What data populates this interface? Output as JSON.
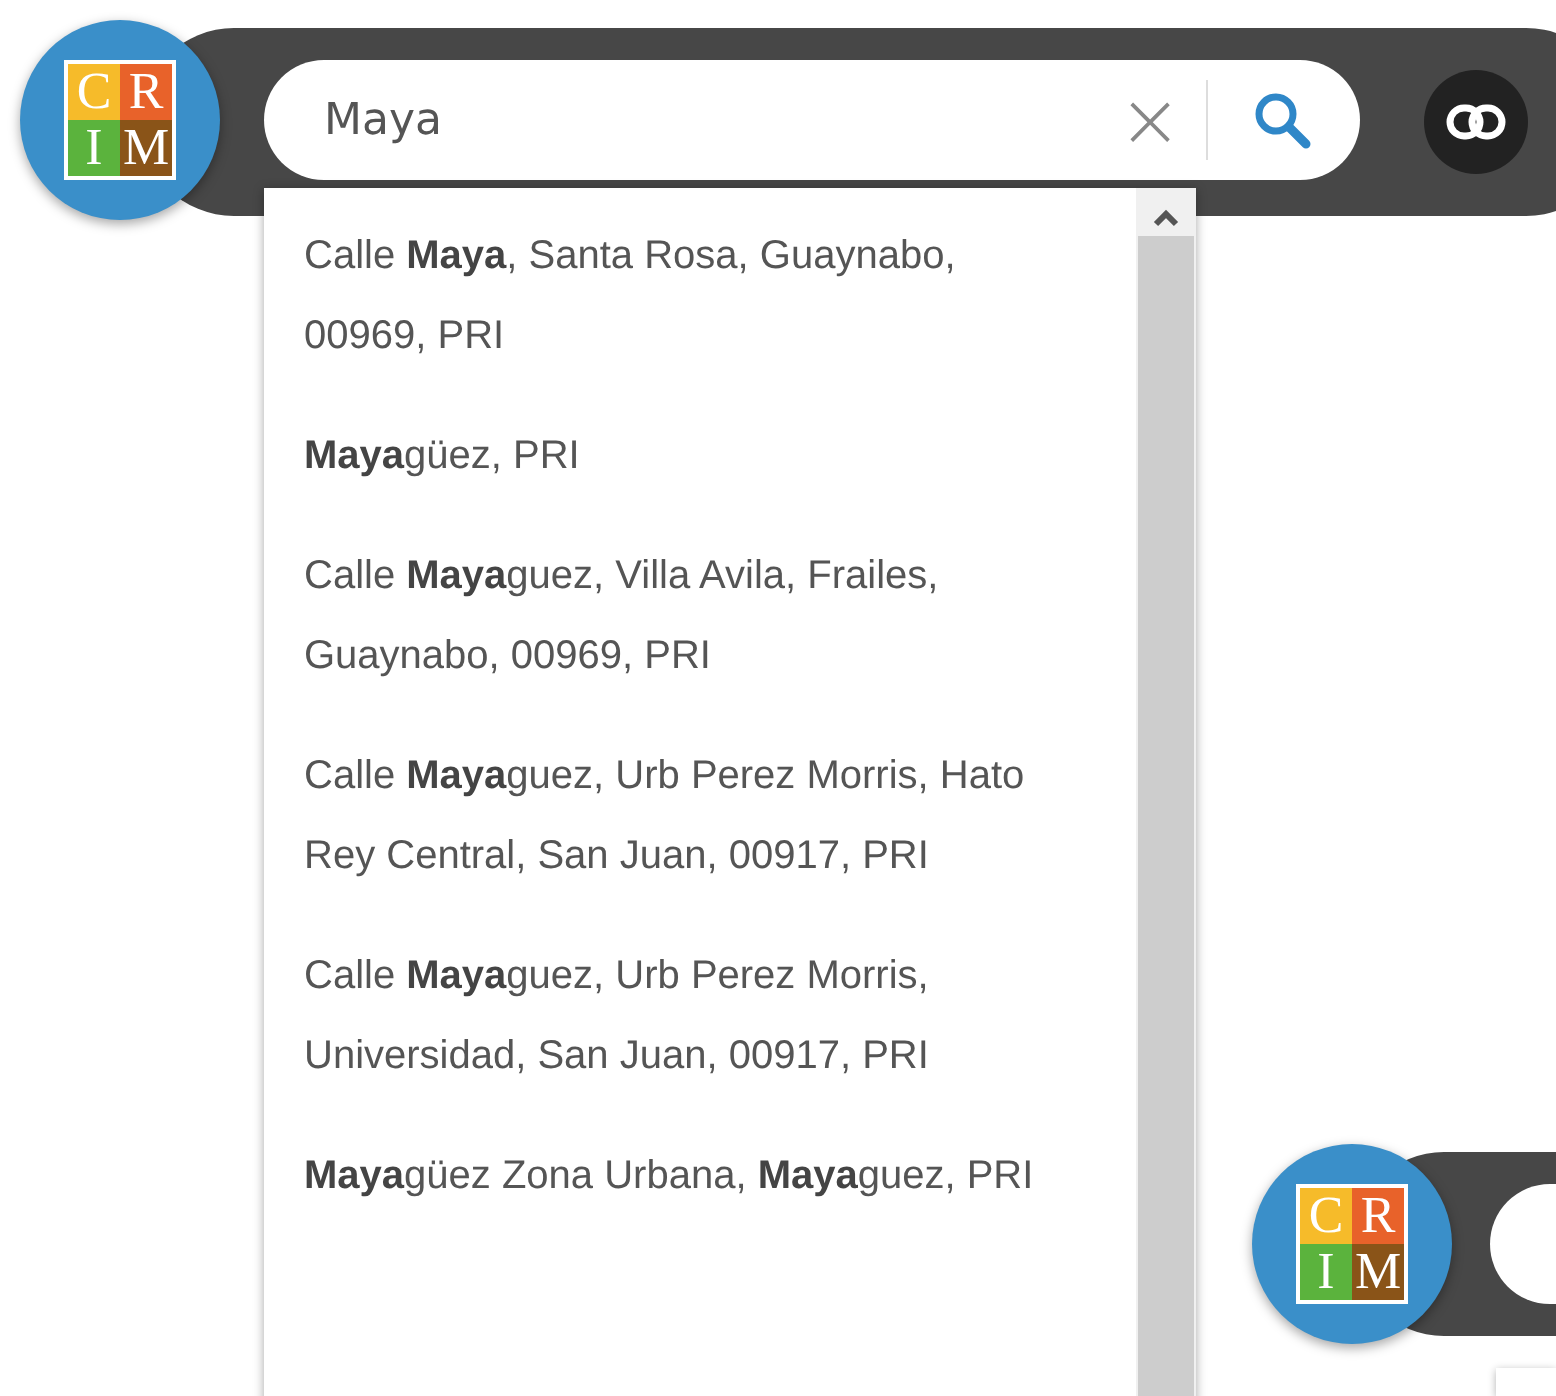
{
  "search_widget": {
    "logo_letters": [
      "C",
      "R",
      "I",
      "M"
    ],
    "query": "Maya",
    "clear_label": "×",
    "suggestions": [
      {
        "text": "Calle **Maya**, Santa Rosa, Guaynabo, 00969, PRI"
      },
      {
        "text": "**Maya**güez, PRI"
      },
      {
        "text": "Calle **Maya**guez, Villa Avila, Frailes, Guaynabo, 00969, PRI"
      },
      {
        "text": "Calle **Maya**guez, Urb Perez Morris, Hato Rey Central, San Juan, 00917, PRI"
      },
      {
        "text": "Calle **Maya**guez, Urb Perez Morris, Universidad, San Juan, 00917, PRI"
      },
      {
        "text": "**Maya**güez Zona Urbana, **Maya**guez, PRI"
      }
    ]
  },
  "second_widget": {
    "logo_letters": [
      "C",
      "R",
      "I",
      "M"
    ]
  }
}
